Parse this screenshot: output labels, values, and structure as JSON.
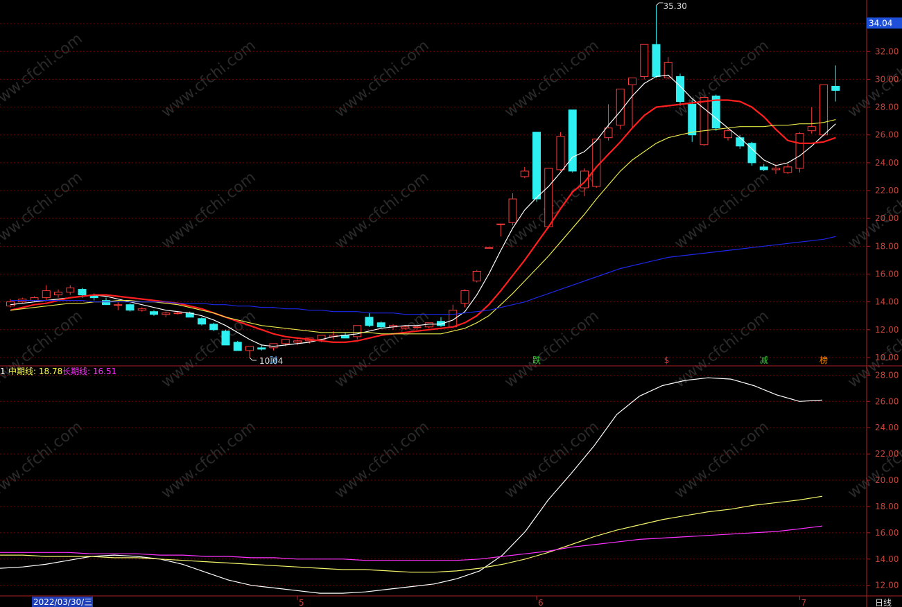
{
  "chart_data": [
    {
      "type": "candlestick",
      "ylim": [
        9.5,
        35.3
      ],
      "y_ticks": [
        "34.00",
        "32.00",
        "30.00",
        "28.00",
        "26.00",
        "24.00",
        "22.00",
        "20.00",
        "18.00",
        "16.00",
        "14.00",
        "12.00",
        "10.00"
      ],
      "current_price": "34.04",
      "high_label": "35.30",
      "low_label": "10.04",
      "candles": [
        {
          "o": 13.7,
          "h": 14.2,
          "l": 13.6,
          "c": 14.0
        },
        {
          "o": 14.0,
          "h": 14.3,
          "l": 13.9,
          "c": 14.2
        },
        {
          "o": 14.1,
          "h": 14.4,
          "l": 14.0,
          "c": 14.3
        },
        {
          "o": 14.3,
          "h": 15.2,
          "l": 14.1,
          "c": 14.8
        },
        {
          "o": 14.5,
          "h": 14.9,
          "l": 14.3,
          "c": 14.7
        },
        {
          "o": 14.7,
          "h": 15.2,
          "l": 14.5,
          "c": 15.0
        },
        {
          "o": 14.9,
          "h": 15.0,
          "l": 14.3,
          "c": 14.5
        },
        {
          "o": 14.5,
          "h": 14.6,
          "l": 14.1,
          "c": 14.3
        },
        {
          "o": 14.1,
          "h": 14.3,
          "l": 13.8,
          "c": 13.8
        },
        {
          "o": 13.8,
          "h": 14.0,
          "l": 13.4,
          "c": 13.8
        },
        {
          "o": 13.8,
          "h": 13.9,
          "l": 13.3,
          "c": 13.4
        },
        {
          "o": 13.4,
          "h": 13.6,
          "l": 13.3,
          "c": 13.5
        },
        {
          "o": 13.3,
          "h": 13.4,
          "l": 13.0,
          "c": 13.1
        },
        {
          "o": 13.1,
          "h": 13.3,
          "l": 12.9,
          "c": 13.2
        },
        {
          "o": 13.2,
          "h": 13.3,
          "l": 13.1,
          "c": 13.2
        },
        {
          "o": 13.2,
          "h": 13.3,
          "l": 12.9,
          "c": 12.9
        },
        {
          "o": 12.8,
          "h": 12.9,
          "l": 12.3,
          "c": 12.4
        },
        {
          "o": 12.4,
          "h": 12.5,
          "l": 11.9,
          "c": 12.0
        },
        {
          "o": 11.9,
          "h": 12.0,
          "l": 10.9,
          "c": 10.9
        },
        {
          "o": 11.1,
          "h": 11.2,
          "l": 10.5,
          "c": 10.5
        },
        {
          "o": 10.5,
          "h": 10.8,
          "l": 10.0,
          "c": 10.8
        },
        {
          "o": 10.7,
          "h": 10.9,
          "l": 10.5,
          "c": 10.6
        },
        {
          "o": 10.7,
          "h": 11.0,
          "l": 10.5,
          "c": 11.0
        },
        {
          "o": 11.0,
          "h": 11.3,
          "l": 10.8,
          "c": 11.3
        },
        {
          "o": 11.1,
          "h": 11.3,
          "l": 10.9,
          "c": 11.2
        },
        {
          "o": 11.2,
          "h": 11.4,
          "l": 11.0,
          "c": 11.4
        },
        {
          "o": 11.3,
          "h": 11.6,
          "l": 11.1,
          "c": 11.6
        },
        {
          "o": 11.5,
          "h": 11.9,
          "l": 11.3,
          "c": 11.6
        },
        {
          "o": 11.6,
          "h": 11.8,
          "l": 11.4,
          "c": 11.4
        },
        {
          "o": 11.5,
          "h": 12.3,
          "l": 11.3,
          "c": 12.3
        },
        {
          "o": 12.9,
          "h": 13.2,
          "l": 12.2,
          "c": 12.3
        },
        {
          "o": 12.5,
          "h": 12.6,
          "l": 12.1,
          "c": 12.2
        },
        {
          "o": 12.2,
          "h": 12.4,
          "l": 12.0,
          "c": 12.3
        },
        {
          "o": 12.1,
          "h": 12.3,
          "l": 12.0,
          "c": 12.2
        },
        {
          "o": 12.2,
          "h": 12.4,
          "l": 12.0,
          "c": 12.2
        },
        {
          "o": 12.2,
          "h": 12.5,
          "l": 12.1,
          "c": 12.5
        },
        {
          "o": 12.6,
          "h": 12.9,
          "l": 12.2,
          "c": 12.3
        },
        {
          "o": 12.2,
          "h": 13.8,
          "l": 12.1,
          "c": 13.4
        },
        {
          "o": 13.9,
          "h": 14.9,
          "l": 13.6,
          "c": 14.8
        },
        {
          "o": 15.5,
          "h": 16.3,
          "l": 15.4,
          "c": 16.2
        },
        {
          "o": 17.9,
          "h": 17.9,
          "l": 17.9,
          "c": 17.9
        },
        {
          "o": 19.6,
          "h": 19.6,
          "l": 18.7,
          "c": 19.6
        },
        {
          "o": 19.7,
          "h": 21.8,
          "l": 19.5,
          "c": 21.4
        },
        {
          "o": 23.0,
          "h": 23.7,
          "l": 22.9,
          "c": 23.4
        },
        {
          "o": 26.2,
          "h": 26.2,
          "l": 21.2,
          "c": 21.4
        },
        {
          "o": 19.4,
          "h": 23.6,
          "l": 19.3,
          "c": 23.6
        },
        {
          "o": 23.5,
          "h": 26.2,
          "l": 23.4,
          "c": 25.9
        },
        {
          "o": 27.8,
          "h": 27.8,
          "l": 23.3,
          "c": 23.4
        },
        {
          "o": 22.2,
          "h": 23.6,
          "l": 21.6,
          "c": 23.4
        },
        {
          "o": 22.3,
          "h": 25.7,
          "l": 22.2,
          "c": 25.7
        },
        {
          "o": 25.8,
          "h": 28.2,
          "l": 25.6,
          "c": 26.5
        },
        {
          "o": 26.7,
          "h": 29.3,
          "l": 26.4,
          "c": 29.3
        },
        {
          "o": 29.6,
          "h": 29.6,
          "l": 26.5,
          "c": 30.1
        },
        {
          "o": 30.2,
          "h": 32.5,
          "l": 30.0,
          "c": 32.5
        },
        {
          "o": 32.5,
          "h": 35.3,
          "l": 30.1,
          "c": 30.2
        },
        {
          "o": 30.1,
          "h": 31.6,
          "l": 30.0,
          "c": 31.2
        },
        {
          "o": 30.2,
          "h": 30.4,
          "l": 28.1,
          "c": 28.4
        },
        {
          "o": 28.2,
          "h": 28.5,
          "l": 25.5,
          "c": 26.0
        },
        {
          "o": 25.3,
          "h": 28.8,
          "l": 25.2,
          "c": 28.7
        },
        {
          "o": 28.8,
          "h": 28.9,
          "l": 26.3,
          "c": 26.5
        },
        {
          "o": 25.8,
          "h": 26.5,
          "l": 25.6,
          "c": 26.3
        },
        {
          "o": 25.8,
          "h": 26.0,
          "l": 25.0,
          "c": 25.2
        },
        {
          "o": 25.4,
          "h": 25.5,
          "l": 23.8,
          "c": 24.0
        },
        {
          "o": 23.7,
          "h": 23.9,
          "l": 23.4,
          "c": 23.5
        },
        {
          "o": 23.5,
          "h": 23.9,
          "l": 23.2,
          "c": 23.6
        },
        {
          "o": 23.3,
          "h": 23.9,
          "l": 23.2,
          "c": 23.7
        },
        {
          "o": 23.6,
          "h": 26.2,
          "l": 23.3,
          "c": 26.1
        },
        {
          "o": 26.3,
          "h": 28.0,
          "l": 26.1,
          "c": 26.6
        },
        {
          "o": 26.0,
          "h": 29.6,
          "l": 25.9,
          "c": 29.6
        },
        {
          "o": 29.5,
          "h": 31.0,
          "l": 28.4,
          "c": 29.2
        }
      ],
      "series": [
        {
          "color": "#ffffff",
          "values": [
            13.8,
            13.9,
            14.0,
            14.1,
            14.2,
            14.3,
            14.4,
            14.5,
            14.4,
            14.2,
            14.0,
            13.8,
            13.6,
            13.4,
            13.3,
            13.2,
            13.0,
            12.7,
            12.3,
            11.8,
            11.3,
            10.9,
            10.8,
            10.9,
            11.0,
            11.1,
            11.3,
            11.5,
            11.6,
            11.7,
            11.9,
            12.1,
            12.2,
            12.3,
            12.3,
            12.4,
            12.4,
            12.7,
            13.3,
            14.5,
            16.0,
            17.7,
            19.3,
            20.6,
            21.5,
            22.3,
            23.3,
            24.4,
            24.8,
            25.6,
            26.7,
            27.7,
            28.8,
            29.7,
            30.2,
            30.3,
            29.5,
            28.6,
            27.9,
            27.2,
            26.5,
            25.8,
            25.0,
            24.2,
            23.8,
            24.0,
            24.5,
            25.2,
            26.0,
            26.8
          ]
        },
        {
          "color": "#ff1f1f",
          "values": [
            13.4,
            13.6,
            13.8,
            13.9,
            14.1,
            14.3,
            14.4,
            14.5,
            14.5,
            14.4,
            14.3,
            14.2,
            14.1,
            14.0,
            13.9,
            13.7,
            13.5,
            13.2,
            12.9,
            12.6,
            12.3,
            12.0,
            11.7,
            11.5,
            11.4,
            11.3,
            11.2,
            11.1,
            11.1,
            11.2,
            11.4,
            11.6,
            11.7,
            11.8,
            11.9,
            12.0,
            12.1,
            12.2,
            12.5,
            13.0,
            13.8,
            14.8,
            15.9,
            17.0,
            18.2,
            19.4,
            20.7,
            21.9,
            22.6,
            23.7,
            24.6,
            25.5,
            26.5,
            27.4,
            28.0,
            28.1,
            28.2,
            28.3,
            28.4,
            28.5,
            28.5,
            28.4,
            28.0,
            27.3,
            26.4,
            25.6,
            25.4,
            25.4,
            25.5,
            25.8
          ]
        },
        {
          "color": "#e8e84a",
          "values": [
            13.4,
            13.5,
            13.6,
            13.7,
            13.8,
            13.9,
            13.9,
            14.0,
            14.0,
            14.1,
            14.1,
            14.0,
            14.0,
            13.9,
            13.8,
            13.6,
            13.4,
            13.2,
            12.9,
            12.7,
            12.5,
            12.3,
            12.2,
            12.1,
            12.0,
            11.9,
            11.8,
            11.8,
            11.8,
            11.8,
            11.8,
            11.7,
            11.7,
            11.7,
            11.7,
            11.7,
            11.7,
            11.9,
            12.1,
            12.5,
            13.0,
            13.8,
            14.6,
            15.5,
            16.4,
            17.3,
            18.3,
            19.3,
            20.3,
            21.4,
            22.4,
            23.4,
            24.2,
            24.8,
            25.4,
            25.8,
            26.0,
            26.2,
            26.3,
            26.4,
            26.5,
            26.6,
            26.6,
            26.6,
            26.7,
            26.7,
            26.8,
            26.8,
            26.9,
            27.1
          ]
        },
        {
          "color": "#1e28e8",
          "values": [
            14.1,
            14.1,
            14.1,
            14.1,
            14.1,
            14.1,
            14.1,
            14.0,
            14.0,
            14.0,
            14.0,
            14.0,
            14.0,
            14.0,
            13.9,
            13.9,
            13.9,
            13.8,
            13.8,
            13.7,
            13.7,
            13.6,
            13.6,
            13.5,
            13.5,
            13.4,
            13.4,
            13.3,
            13.3,
            13.3,
            13.2,
            13.2,
            13.2,
            13.1,
            13.1,
            13.1,
            13.1,
            13.1,
            13.2,
            13.3,
            13.4,
            13.6,
            13.8,
            14.0,
            14.3,
            14.6,
            14.9,
            15.2,
            15.5,
            15.8,
            16.1,
            16.4,
            16.6,
            16.8,
            17.0,
            17.2,
            17.3,
            17.4,
            17.5,
            17.6,
            17.7,
            17.8,
            17.9,
            18.0,
            18.1,
            18.2,
            18.3,
            18.4,
            18.5,
            18.7
          ]
        }
      ],
      "markers": [
        {
          "index": 22,
          "label": "财",
          "color": "#5fb7ff"
        },
        {
          "index": 44,
          "label": "跌",
          "color": "#3ad13a"
        },
        {
          "index": 55,
          "label": "$",
          "color": "#ff3030"
        },
        {
          "index": 63,
          "label": "减",
          "color": "#3ad13a"
        },
        {
          "index": 68,
          "label": "榜",
          "color": "#ff8800"
        }
      ]
    },
    {
      "type": "line",
      "ylim": [
        11.3,
        28.6
      ],
      "y_ticks": [
        "28.00",
        "26.00",
        "24.00",
        "22.00",
        "20.00",
        "18.00",
        "16.00",
        "14.00",
        "12.00"
      ],
      "legend": [
        {
          "text": "1",
          "color": "#ffffff"
        },
        {
          "text": "中期线: 18.78",
          "color": "#ffff4a"
        },
        {
          "text": "长期线: 16.51",
          "color": "#ff33ff"
        }
      ],
      "series": [
        {
          "color": "#ffffff",
          "values": [
            13.3,
            13.4,
            13.6,
            13.9,
            14.2,
            14.3,
            14.2,
            14.0,
            13.6,
            13.0,
            12.4,
            12.0,
            11.8,
            11.6,
            11.4,
            11.4,
            11.5,
            11.7,
            11.9,
            12.1,
            12.5,
            13.1,
            14.3,
            16.1,
            18.5,
            20.5,
            22.6,
            25.0,
            26.4,
            27.2,
            27.6,
            27.8,
            27.7,
            27.2,
            26.5,
            26.0,
            26.1
          ]
        },
        {
          "color": "#f5f56a",
          "values": [
            14.3,
            14.3,
            14.2,
            14.2,
            14.2,
            14.1,
            14.1,
            14.0,
            13.9,
            13.8,
            13.7,
            13.6,
            13.5,
            13.4,
            13.3,
            13.2,
            13.2,
            13.1,
            13.0,
            13.0,
            13.1,
            13.3,
            13.6,
            14.0,
            14.5,
            15.1,
            15.7,
            16.2,
            16.6,
            17.0,
            17.3,
            17.6,
            17.8,
            18.1,
            18.3,
            18.5,
            18.78
          ]
        },
        {
          "color": "#ff33ff",
          "values": [
            14.5,
            14.5,
            14.5,
            14.5,
            14.4,
            14.4,
            14.4,
            14.3,
            14.3,
            14.2,
            14.2,
            14.1,
            14.1,
            14.0,
            14.0,
            14.0,
            13.9,
            13.9,
            13.9,
            13.9,
            13.9,
            14.0,
            14.2,
            14.4,
            14.6,
            14.9,
            15.1,
            15.3,
            15.5,
            15.6,
            15.7,
            15.8,
            15.9,
            16.0,
            16.1,
            16.3,
            16.51
          ]
        }
      ]
    }
  ],
  "axis": {
    "date_label": "2022/03/30/三",
    "month_labels": [
      {
        "label": "5",
        "index": 24
      },
      {
        "label": "6",
        "index": 44
      },
      {
        "label": "7",
        "index": 66
      }
    ],
    "period_label": "日线"
  },
  "watermark": "www.cfchi.com",
  "colors": {
    "up": "#ff3b3b",
    "down": "#2ef0f0",
    "grid": "#7a0000",
    "axis": "#b02020",
    "text": "#c8443c"
  }
}
